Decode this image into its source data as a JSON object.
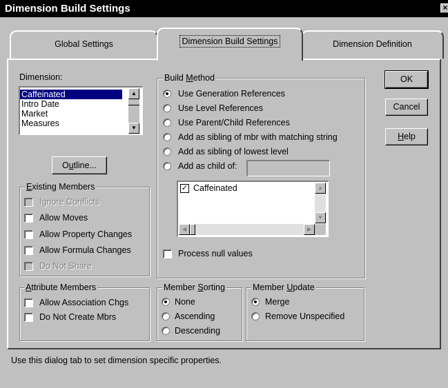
{
  "window": {
    "title": "Dimension Build Settings",
    "close_glyph": "×"
  },
  "tabs": [
    {
      "label": "Global Settings"
    },
    {
      "label": "Dimension Build Settings"
    },
    {
      "label": "Dimension Definition"
    }
  ],
  "dimension": {
    "label": "Dimension:",
    "items": [
      "Caffeinated",
      "Intro Date",
      "Market",
      "Measures"
    ],
    "selected": "Caffeinated"
  },
  "outline_button": {
    "pre": "O",
    "u": "u",
    "post": "tline..."
  },
  "existing_members": {
    "legend_u": "E",
    "legend_rest": "xisting Members",
    "options": [
      {
        "label": "Ignore Conflicts",
        "checked": false,
        "disabled": true
      },
      {
        "label": "Allow Moves",
        "checked": false,
        "disabled": false
      },
      {
        "label": "Allow Property Changes",
        "checked": false,
        "disabled": false
      },
      {
        "label": "Allow Formula Changes",
        "checked": false,
        "disabled": false
      },
      {
        "label": "Do Not Share",
        "checked": false,
        "disabled": true
      }
    ]
  },
  "attribute_members": {
    "legend_u": "A",
    "legend_rest": "ttribute Members",
    "options": [
      {
        "label": "Allow Association Chgs",
        "checked": false
      },
      {
        "label": "Do Not Create Mbrs",
        "checked": false
      }
    ]
  },
  "build_method": {
    "legend_pre": "Build ",
    "legend_u": "M",
    "legend_rest": "ethod",
    "options": [
      {
        "label": "Use Generation References",
        "selected": true
      },
      {
        "label": "Use Level References",
        "selected": false
      },
      {
        "label": "Use Parent/Child References",
        "selected": false
      },
      {
        "label": "Add as sibling of mbr with matching string",
        "selected": false
      },
      {
        "label": "Add as sibling of lowest level",
        "selected": false
      },
      {
        "label": "Add as child of:",
        "selected": false
      }
    ],
    "child_of_value": "",
    "tree_item": {
      "label": "Caffeinated",
      "check_glyph": "✓"
    },
    "process_null": {
      "label": "Process null values",
      "checked": false
    }
  },
  "member_sorting": {
    "legend_pre": "Member ",
    "legend_u": "S",
    "legend_rest": "orting",
    "options": [
      {
        "label": "None",
        "selected": true
      },
      {
        "label": "Ascending",
        "selected": false
      },
      {
        "label": "Descending",
        "selected": false
      }
    ]
  },
  "member_update": {
    "legend_pre": "Member ",
    "legend_u": "U",
    "legend_rest": "pdate",
    "options": [
      {
        "label": "Merge",
        "selected": true
      },
      {
        "label": "Remove Unspecified",
        "selected": false
      }
    ]
  },
  "buttons": {
    "ok": "OK",
    "cancel": "Cancel",
    "help_u": "H",
    "help_rest": "elp"
  },
  "status_text": "Use this dialog tab to set dimension specific properties."
}
